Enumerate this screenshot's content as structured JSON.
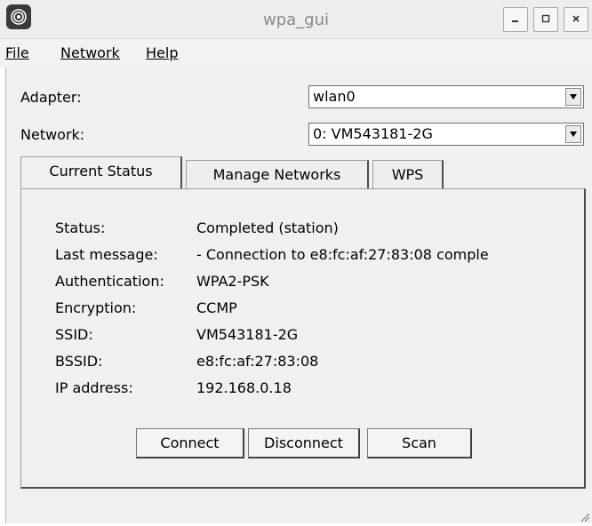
{
  "window": {
    "title": "wpa_gui",
    "minimize_icon": "minimize-icon",
    "maximize_icon": "maximize-icon",
    "close_icon": "close-icon"
  },
  "menu": {
    "items": [
      {
        "label": "File"
      },
      {
        "label": "Network"
      },
      {
        "label": "Help"
      }
    ]
  },
  "adapter": {
    "label": "Adapter:",
    "value": "wlan0"
  },
  "network": {
    "label": "Network:",
    "value": "0: VM543181-2G"
  },
  "tabs": [
    {
      "label": "Current Status",
      "active": true
    },
    {
      "label": "Manage Networks",
      "active": false
    },
    {
      "label": "WPS",
      "active": false
    }
  ],
  "status": {
    "rows": [
      {
        "label": "Status:",
        "value": "Completed (station)"
      },
      {
        "label": "Last message:",
        "value": "- Connection to e8:fc:af:27:83:08 comple"
      },
      {
        "label": "Authentication:",
        "value": "WPA2-PSK"
      },
      {
        "label": "Encryption:",
        "value": "CCMP"
      },
      {
        "label": "SSID:",
        "value": "VM543181-2G"
      },
      {
        "label": "BSSID:",
        "value": "e8:fc:af:27:83:08"
      },
      {
        "label": "IP address:",
        "value": "192.168.0.18"
      }
    ]
  },
  "buttons": {
    "connect": "Connect",
    "disconnect": "Disconnect",
    "scan": "Scan"
  },
  "colors": {
    "window_bg": "#f0f0f0",
    "titlebar_bg": "#ededed",
    "title_text": "#888888"
  }
}
